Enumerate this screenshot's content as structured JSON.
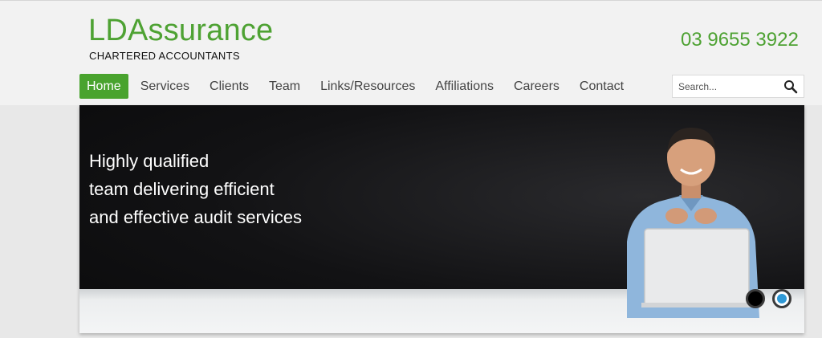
{
  "brand": {
    "name": "LDAssurance",
    "tagline": "CHARTERED ACCOUNTANTS",
    "phone": "03 9655 3922",
    "color": "#4ea233"
  },
  "nav": {
    "items": [
      {
        "label": "Home",
        "active": true
      },
      {
        "label": "Services"
      },
      {
        "label": "Clients"
      },
      {
        "label": "Team"
      },
      {
        "label": "Links/Resources"
      },
      {
        "label": "Affiliations"
      },
      {
        "label": "Careers"
      },
      {
        "label": "Contact"
      }
    ]
  },
  "search": {
    "placeholder": "Search...",
    "icon": "search-icon"
  },
  "banner": {
    "lines": [
      "Highly qualified",
      "team delivering efficient",
      "and effective audit services"
    ],
    "slides": {
      "count": 2,
      "active_index": 1
    }
  }
}
